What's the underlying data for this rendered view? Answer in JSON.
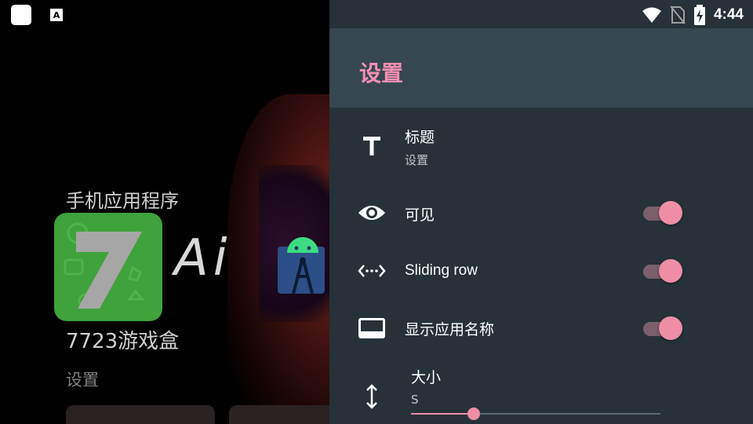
{
  "launcher": {
    "folder_title": "手机应用程序",
    "app_7723_label": "7723游戏盒",
    "ai_app_text": "Ai",
    "settings_label": "设置",
    "status_icon_letter": "A"
  },
  "statusbar": {
    "time": "4:44",
    "icons": [
      "wifi-icon",
      "no-sim-icon",
      "battery-charging-icon"
    ]
  },
  "drawer": {
    "title": "设置",
    "rows": {
      "title": {
        "label": "标题",
        "value": "设置",
        "icon": "text-t-icon"
      },
      "visible": {
        "label": "可见",
        "icon": "eye-icon",
        "enabled": true
      },
      "sliding_row": {
        "label": "Sliding row",
        "icon": "horizontal-arrows-icon",
        "enabled": true
      },
      "show_app_name": {
        "label": "显示应用名称",
        "icon": "label-box-icon",
        "enabled": true
      },
      "size": {
        "label": "大小",
        "value": "S",
        "icon": "vertical-arrows-icon",
        "level": 0.25
      }
    }
  },
  "colors": {
    "drawer_bg": "#263238",
    "appbar_bg": "#37474f",
    "accent": "#f48fb1"
  }
}
